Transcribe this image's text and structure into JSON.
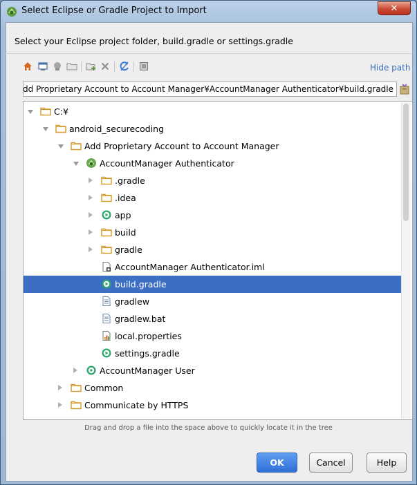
{
  "window": {
    "title": "Select Eclipse or Gradle Project to Import",
    "close_label": "✕"
  },
  "instruction": "Select your Eclipse project folder, build.gradle or settings.gradle",
  "toolbar": {
    "icons": [
      "home-icon",
      "desktop-icon",
      "project-icon",
      "module-icon",
      "new-folder-icon",
      "delete-icon",
      "refresh-icon",
      "show-hidden-icon"
    ],
    "hide_path_label": "Hide path"
  },
  "path": {
    "value": "Add Proprietary Account to Account Manager¥AccountManager Authenticator¥build.gradle"
  },
  "tree": {
    "rows": [
      {
        "label": "C:¥",
        "depth": 0,
        "arrow": "down",
        "icon": "folder-icon",
        "selected": false
      },
      {
        "label": "android_securecoding",
        "depth": 1,
        "arrow": "down",
        "icon": "folder-icon",
        "selected": false
      },
      {
        "label": "Add Proprietary Account to Account Manager",
        "depth": 2,
        "arrow": "down",
        "icon": "folder-icon",
        "selected": false
      },
      {
        "label": "AccountManager Authenticator",
        "depth": 3,
        "arrow": "down",
        "icon": "android-project-icon",
        "selected": false
      },
      {
        "label": ".gradle",
        "depth": 4,
        "arrow": "right",
        "icon": "folder-icon",
        "selected": false
      },
      {
        "label": ".idea",
        "depth": 4,
        "arrow": "right",
        "icon": "folder-icon",
        "selected": false
      },
      {
        "label": "app",
        "depth": 4,
        "arrow": "right",
        "icon": "gradle-module-icon",
        "selected": false
      },
      {
        "label": "build",
        "depth": 4,
        "arrow": "right",
        "icon": "folder-icon",
        "selected": false
      },
      {
        "label": "gradle",
        "depth": 4,
        "arrow": "right",
        "icon": "folder-icon",
        "selected": false
      },
      {
        "label": "AccountManager Authenticator.iml",
        "depth": 4,
        "arrow": "none",
        "icon": "iml-file-icon",
        "selected": false
      },
      {
        "label": "build.gradle",
        "depth": 4,
        "arrow": "none",
        "icon": "gradle-file-icon",
        "selected": true
      },
      {
        "label": "gradlew",
        "depth": 4,
        "arrow": "none",
        "icon": "text-file-icon",
        "selected": false
      },
      {
        "label": "gradlew.bat",
        "depth": 4,
        "arrow": "none",
        "icon": "text-file-icon",
        "selected": false
      },
      {
        "label": "local.properties",
        "depth": 4,
        "arrow": "none",
        "icon": "properties-file-icon",
        "selected": false
      },
      {
        "label": "settings.gradle",
        "depth": 4,
        "arrow": "none",
        "icon": "gradle-file-icon",
        "selected": false
      },
      {
        "label": "AccountManager User",
        "depth": 3,
        "arrow": "right",
        "icon": "gradle-module-icon",
        "selected": false
      },
      {
        "label": "Common",
        "depth": 2,
        "arrow": "right",
        "icon": "folder-icon",
        "selected": false
      },
      {
        "label": "Communicate by HTTPS",
        "depth": 2,
        "arrow": "right",
        "icon": "folder-icon",
        "selected": false
      }
    ]
  },
  "hint": "Drag and drop a file into the space above to quickly locate it in the tree",
  "buttons": {
    "ok": "OK",
    "cancel": "Cancel",
    "help": "Help"
  },
  "colors": {
    "selection": "#3c6fc4",
    "folder": "#d49a2a",
    "gradle_green": "#2fa66b",
    "link": "#3a6fb8",
    "ok_button": "#2f6fd6"
  }
}
